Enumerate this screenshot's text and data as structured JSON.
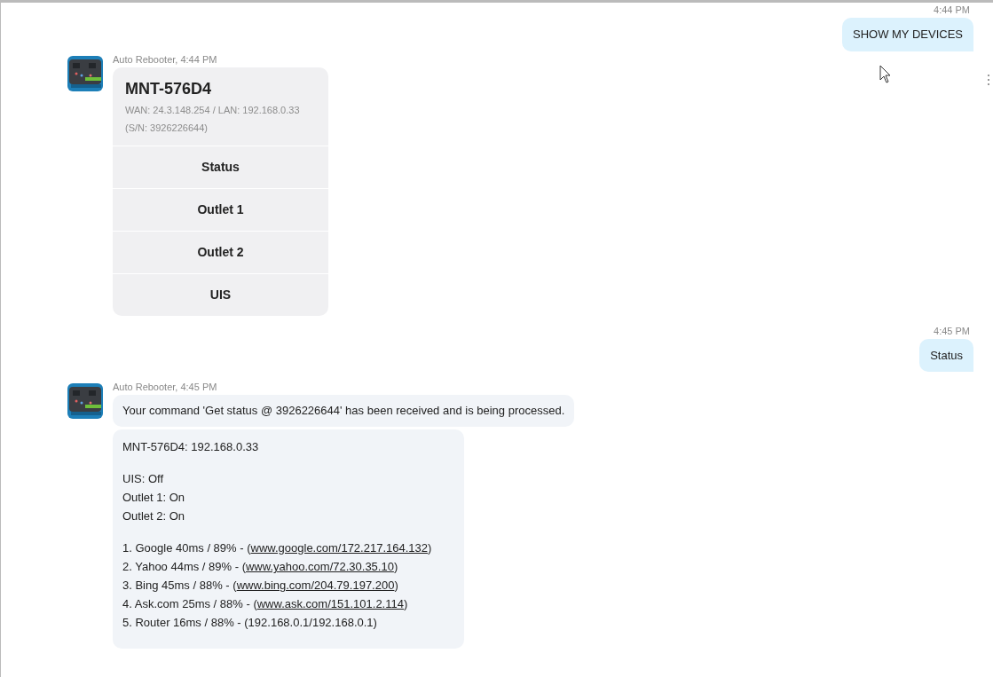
{
  "messages": [
    {
      "kind": "outgoing",
      "time": "4:44 PM",
      "text": "SHOW MY DEVICES"
    },
    {
      "kind": "card",
      "sender": "Auto Rebooter, 4:44 PM",
      "title": "MNT-576D4",
      "subtitle": "WAN: 24.3.148.254 / LAN: 192.168.0.33",
      "serial": "(S/N: 3926226644)",
      "buttons": [
        "Status",
        "Outlet 1",
        "Outlet 2",
        "UIS"
      ]
    },
    {
      "kind": "outgoing",
      "time": "4:45 PM",
      "text": "Status"
    },
    {
      "kind": "status",
      "sender": "Auto Rebooter, 4:45 PM",
      "notice": "Your command 'Get status @ 3926226644' has been received and is being processed.",
      "groups": [
        [
          {
            "text": "MNT-576D4: 192.168.0.33"
          }
        ],
        [
          {
            "text": "UIS: Off"
          },
          {
            "text": "Outlet 1: On"
          },
          {
            "text": "Outlet 2: On"
          }
        ],
        [
          {
            "text": "1. Google 40ms / 89% - (",
            "link": "www.google.com/172.217.164.132",
            "after": ")"
          },
          {
            "text": "2. Yahoo 44ms / 89% - (",
            "link": "www.yahoo.com/72.30.35.10",
            "after": ")"
          },
          {
            "text": "3. Bing 45ms / 88% - (",
            "link": "www.bing.com/204.79.197.200",
            "after": ")"
          },
          {
            "text": "4. Ask.com 25ms / 88% - (",
            "link": "www.ask.com/151.101.2.114",
            "after": ")"
          },
          {
            "text": "5. Router 16ms / 88% - (192.168.0.1/192.168.0.1)"
          }
        ]
      ]
    }
  ]
}
